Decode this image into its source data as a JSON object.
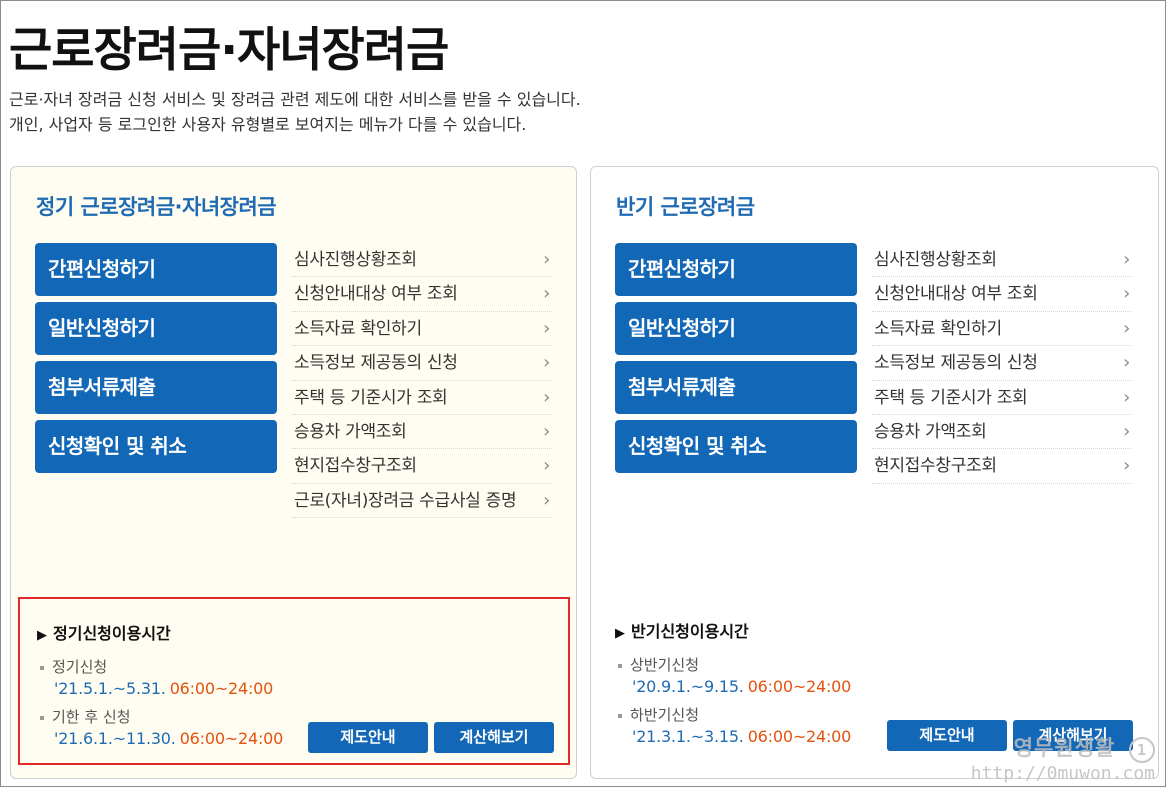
{
  "page": {
    "title": "근로장려금·자녀장려금",
    "desc_line1": "근로·자녀 장려금 신청 서비스 및 장려금 관련 제도에 대한 서비스를 받을 수 있습니다.",
    "desc_line2": "개인, 사업자 등 로그인한 사용자 유형별로 보여지는 메뉴가 다를 수 있습니다."
  },
  "left_panel": {
    "title": "정기 근로장려금·자녀장려금",
    "buttons": [
      "간편신청하기",
      "일반신청하기",
      "첨부서류제출",
      "신청확인 및 취소"
    ],
    "links": [
      "심사진행상황조회",
      "신청안내대상 여부 조회",
      "소득자료 확인하기",
      "소득정보 제공동의 신청",
      "주택 등 기준시가 조회",
      "승용차 가액조회",
      "현지접수창구조회",
      "근로(자녀)장려금 수급사실 증명"
    ],
    "time": {
      "title": "정기신청이용시간",
      "item1_label": "정기신청",
      "item1_date": "'21.5.1.~5.31.",
      "item1_hours": "06:00~24:00",
      "item2_label": "기한 후 신청",
      "item2_date": "'21.6.1.~11.30.",
      "item2_hours": "06:00~24:00"
    },
    "info_button": "제도안내",
    "calc_button": "계산해보기"
  },
  "right_panel": {
    "title": "반기 근로장려금",
    "buttons": [
      "간편신청하기",
      "일반신청하기",
      "첨부서류제출",
      "신청확인 및 취소"
    ],
    "links": [
      "심사진행상황조회",
      "신청안내대상 여부 조회",
      "소득자료 확인하기",
      "소득정보 제공동의 신청",
      "주택 등 기준시가 조회",
      "승용차 가액조회",
      "현지접수창구조회"
    ],
    "time": {
      "title": "반기신청이용시간",
      "item1_label": "상반기신청",
      "item1_date": "'20.9.1.~9.15.",
      "item1_hours": "06:00~24:00",
      "item2_label": "하반기신청",
      "item2_date": "'21.3.1.~3.15.",
      "item2_hours": "06:00~24:00"
    },
    "info_button": "제도안내",
    "calc_button": "계산해보기"
  },
  "icons": {
    "chevron": "chevron-right-icon",
    "triangle": "triangle-right-icon"
  },
  "watermark": {
    "name": "영무원생활",
    "badge": "1",
    "url": "http://0muwon.com"
  },
  "colors": {
    "accent_blue": "#1267b6",
    "title_blue": "#1f6bb3",
    "hours_orange": "#e4520f",
    "highlight_red": "#e02a2a",
    "left_panel_bg": "#fffdf1"
  }
}
